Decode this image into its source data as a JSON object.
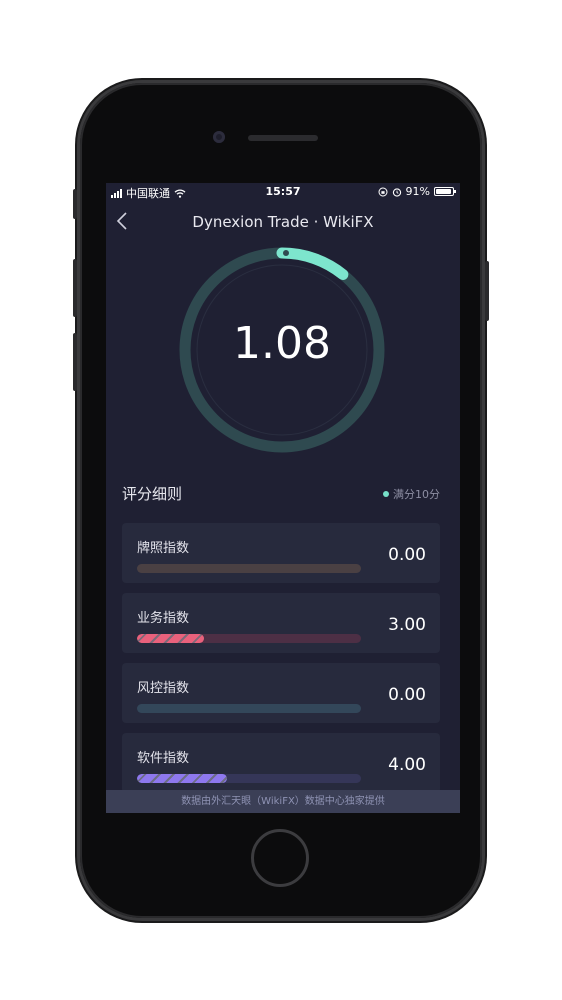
{
  "status_bar": {
    "carrier": "中国联通",
    "time": "15:57",
    "battery": "91%",
    "battery_level": 0.91
  },
  "nav": {
    "title": "Dynexion Trade · WikiFX",
    "back_icon": "chevron-left-icon"
  },
  "score": {
    "value": "1.08",
    "max": 10,
    "fraction": 0.108,
    "colors": {
      "track": "#2f4a50",
      "arc": "#7de5cd"
    }
  },
  "breakdown": {
    "title": "评分细则",
    "legend": "满分10分",
    "items": [
      {
        "label": "牌照指数",
        "value": "0.00",
        "fraction": 0.0,
        "track_color": "#4a4043",
        "fill_color": "#e05a79"
      },
      {
        "label": "业务指数",
        "value": "3.00",
        "fraction": 0.3,
        "track_color": "#4d2f45",
        "fill_color": "#e9617c"
      },
      {
        "label": "风控指数",
        "value": "0.00",
        "fraction": 0.0,
        "track_color": "#33475a",
        "fill_color": "#5c7ea0"
      },
      {
        "label": "软件指数",
        "value": "4.00",
        "fraction": 0.4,
        "track_color": "#353658",
        "fill_color": "#8e78ee"
      }
    ]
  },
  "footer": {
    "text": "数据由外汇天眼（WikiFX）数据中心独家提供"
  }
}
